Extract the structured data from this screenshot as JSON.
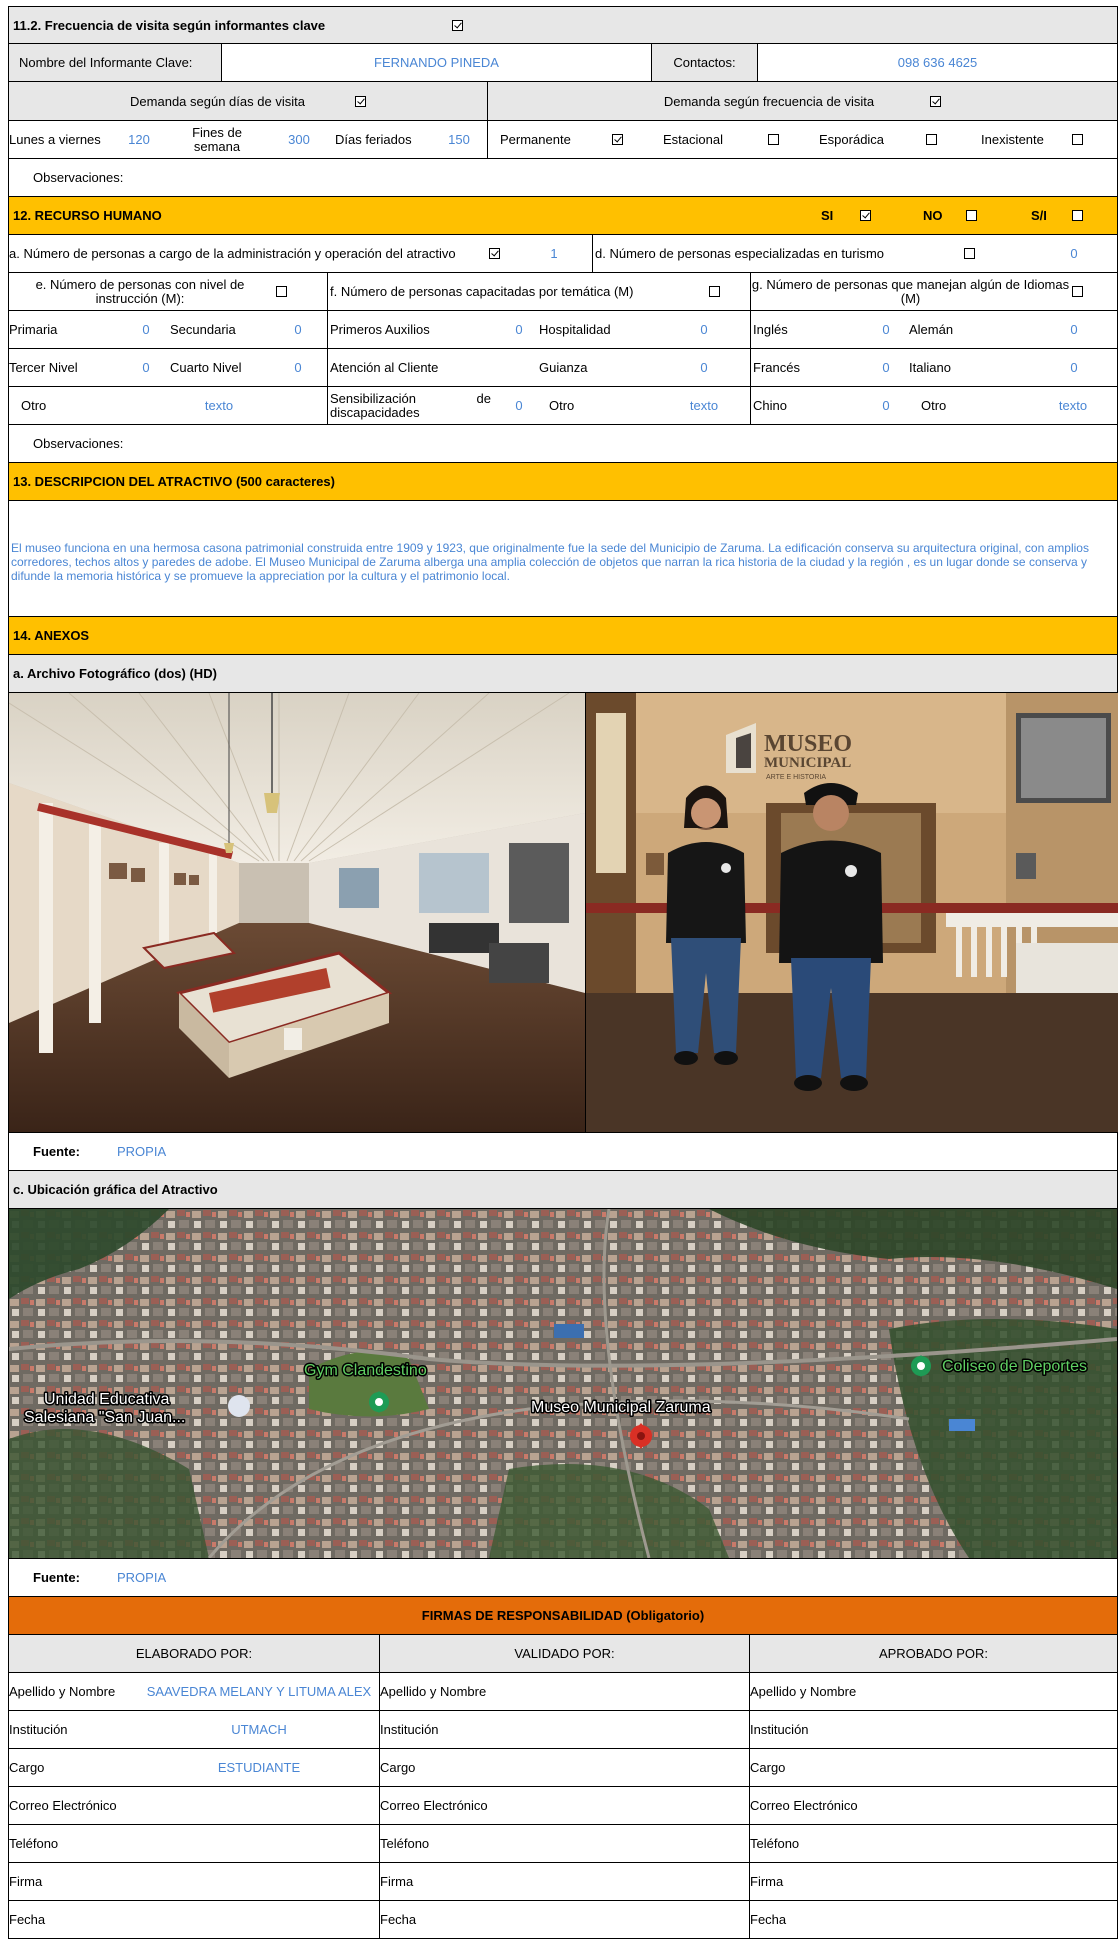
{
  "s11": {
    "title": "11.2. Frecuencia de visita según informantes clave",
    "title_checked": true,
    "informant_label": "Nombre del Informante Clave:",
    "informant_value": "FERNANDO PINEDA",
    "contacts_label": "Contactos:",
    "contacts_value": "098 636 4625",
    "demand_days_label": "Demanda según  días de visita",
    "demand_days_checked": true,
    "demand_freq_label": "Demanda según frecuencia de visita",
    "demand_freq_checked": true,
    "weekdays_label": "Lunes a viernes",
    "weekdays_value": "120",
    "weekends_label": "Fines de semana",
    "weekends_value": "300",
    "holidays_label": "Días feriados",
    "holidays_value": "150",
    "permanent_label": "Permanente",
    "permanent_checked": true,
    "seasonal_label": "Estacional",
    "seasonal_checked": false,
    "sporadic_label": "Esporádica",
    "sporadic_checked": false,
    "nonexistent_label": "Inexistente",
    "nonexistent_checked": false,
    "observations_label": "Observaciones:"
  },
  "s12": {
    "title": "12. RECURSO HUMANO",
    "si_label": "SI",
    "si_checked": true,
    "no_label": "NO",
    "no_checked": false,
    "sn_label": "S/I",
    "sn_checked": false,
    "a_label": "a. Número de personas a cargo de la administración y operación del atractivo",
    "a_checked": true,
    "a_value": "1",
    "d_label": "d. Número de personas especializadas en turismo",
    "d_checked": false,
    "d_value": "0",
    "e_label": "e. Número de personas con nivel de instrucción (M):",
    "e_checked": false,
    "f_label": "f. Número de personas capacitadas por temática (M)",
    "f_checked": false,
    "g_label": "g. Número de personas que manejan algún de Idiomas (M)",
    "g_checked": false,
    "primaria_label": "Primaria",
    "primaria_value": "0",
    "secundaria_label": "Secundaria",
    "secundaria_value": "0",
    "tercer_label": "Tercer Nivel",
    "tercer_value": "0",
    "cuarto_label": "Cuarto Nivel",
    "cuarto_value": "0",
    "otro_e_label": "Otro",
    "otro_e_value": "texto",
    "auxilios_label": "Primeros Auxilios",
    "auxilios_value": "0",
    "hospitalidad_label": "Hospitalidad",
    "hospitalidad_value": "0",
    "atencion_label": "Atención al Cliente",
    "guianza_label": "Guianza",
    "guianza_value": "0",
    "sensib_label": "Sensibilización de discapacidades",
    "sensib_value": "0",
    "otro_f_label": "Otro",
    "otro_f_value": "texto",
    "ingles_label": "Inglés",
    "ingles_value": "0",
    "aleman_label": "Alemán",
    "aleman_value": "0",
    "frances_label": "Francés",
    "frances_value": "0",
    "italiano_label": "Italiano",
    "italiano_value": "0",
    "chino_label": "Chino",
    "chino_value": "0",
    "otro_g_label": "Otro",
    "otro_g_value": "texto",
    "observations_label": "Observaciones:"
  },
  "s13": {
    "title": "13. DESCRIPCION DEL ATRACTIVO (500 caracteres)",
    "text": "El museo funciona en una hermosa casona patrimonial construida entre 1909 y 1923, que originalmente fue la sede del Municipio de Zaruma. La edificación conserva su arquitectura original, con amplios corredores, techos altos y paredes de adobe. El Museo Municipal de Zaruma alberga una amplia colección de objetos que narran la rica historia de la ciudad y la región , es un lugar donde se conserva y difunde la memoria histórica y se promueve la appreciation por la cultura y el patrimonio local."
  },
  "s14": {
    "title": "14. ANEXOS",
    "photos_title": "a. Archivo Fotográfico (dos) (HD)",
    "photo_sign_line1": "MUSEO",
    "photo_sign_line2": "MUNICIPAL",
    "photo_sign_line3": "ARTE E HISTORIA",
    "source_label": "Fuente:",
    "source_value": "PROPIA",
    "map_title": "c. Ubicación gráfica del Atractivo",
    "map_labels": {
      "gym": "Gym Clandestino",
      "coliseo": "Coliseo de Deportes",
      "unidad_line1": "Unidad Educativa",
      "unidad_line2": "Salesiana \"San Juan...",
      "museo": "Museo Municipal Zaruma"
    },
    "map_source_label": "Fuente:",
    "map_source_value": "PROPIA"
  },
  "firmas": {
    "title": "FIRMAS DE RESPONSABILIDAD (Obligatorio)",
    "col1": "ELABORADO POR:",
    "col2": "VALIDADO  POR:",
    "col3": "APROBADO POR:",
    "rows": [
      "Apellido y Nombre",
      "Institución",
      "Cargo",
      "Correo Electrónico",
      "Teléfono",
      "Firma",
      "Fecha"
    ],
    "elaborado_values": [
      "SAAVEDRA MELANY Y LITUMA ALEX",
      "UTMACH",
      "ESTUDIANTE",
      "",
      "",
      "",
      ""
    ]
  },
  "colors": {
    "section_yellow": "#ffc000",
    "signature_orange": "#e46c0a",
    "header_gray": "#e7e7e7",
    "value_blue": "#4a86d4"
  }
}
